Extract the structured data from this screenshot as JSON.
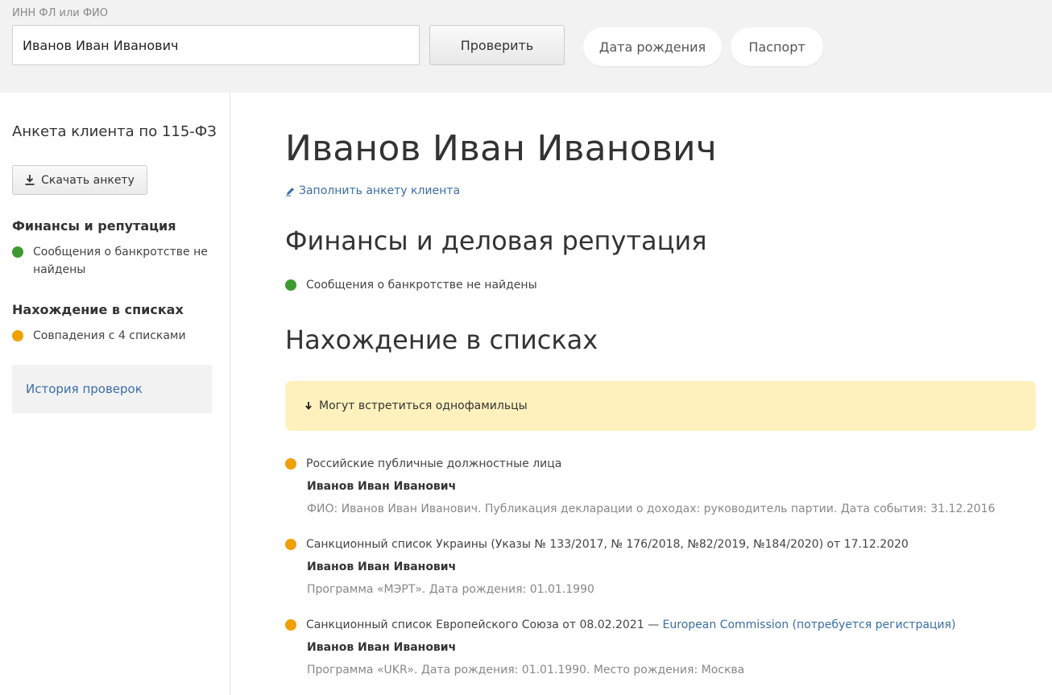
{
  "colors": {
    "ok": "#3c9a2e",
    "warning": "#f0a000",
    "link": "#3a6ea5",
    "notice_bg": "#fff1bd"
  },
  "search": {
    "label": "ИНН ФЛ или ФИО",
    "value": "Иванов Иван Иванович",
    "check_button": "Проверить",
    "dob_button": "Дата рождения",
    "passport_button": "Паспорт"
  },
  "sidebar": {
    "title": "Анкета клиента по 115-ФЗ",
    "download_button": "Скачать анкету",
    "download_icon": "download-icon",
    "finance_title": "Финансы и репутация",
    "finance_item": "Сообщения о банкротстве не найдены",
    "lists_title": "Нахождение в списках",
    "lists_item": "Совпадения с 4 списками",
    "history_link": "История проверок"
  },
  "main": {
    "name": "Иванов Иван Иванович",
    "fill_link": "Заполнить анкету клиента",
    "fill_icon": "pencil-icon",
    "finance_heading": "Финансы и деловая репутация",
    "finance_status": "Сообщения о банкротстве не найдены",
    "lists_heading": "Нахождение в списках",
    "notice": "Могут встретиться однофамильцы",
    "notice_icon": "arrow-down-icon",
    "matches": [
      {
        "list": "Российские публичные должностные лица",
        "name": "Иванов Иван Иванович",
        "detail": "ФИО: Иванов Иван Иванович. Публикация декларации о доходах: руководитель партии. Дата события: 31.12.2016"
      },
      {
        "list": "Санкционный список Украины (Указы № 133/2017, № 176/2018, №82/2019, №184/2020) от 17.12.2020",
        "name": "Иванов Иван Иванович",
        "detail": "Программа «МЭРТ». Дата рождения: 01.01.1990"
      },
      {
        "list": "Санкционный список Европейского Союза от 08.02.2021 — ",
        "link": "European Commission (потребуется регистрация)",
        "name": "Иванов Иван Иванович",
        "detail": "Программа «UKR». Дата рождения: 01.01.1990. Место рождения: Москва"
      }
    ]
  }
}
